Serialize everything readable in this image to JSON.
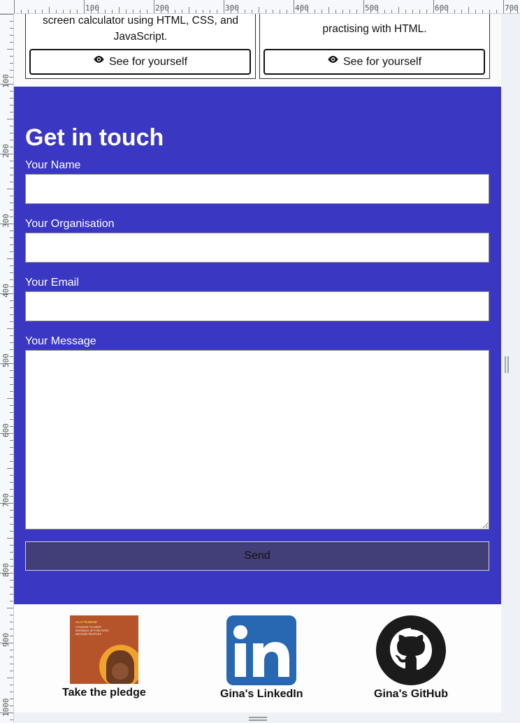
{
  "rulers": {
    "top_labels": [
      "100",
      "200",
      "300",
      "400",
      "500",
      "600",
      "700"
    ],
    "left_labels": [
      "100",
      "200",
      "300",
      "400",
      "500",
      "600",
      "700",
      "800",
      "900",
      "1000"
    ]
  },
  "projects": [
    {
      "description_lines": [
        "screen calculator using HTML, CSS, and",
        "JavaScript."
      ],
      "button_label": "See for yourself",
      "icon": "eye-icon"
    },
    {
      "description_lines": [
        "practising with HTML."
      ],
      "button_label": "See for yourself",
      "icon": "eye-icon"
    }
  ],
  "contact": {
    "title": "Get in touch",
    "bg_color": "#3a37c2",
    "fields": [
      {
        "label": "Your Name",
        "value": "",
        "placeholder": ""
      },
      {
        "label": "Your Organisation",
        "value": "",
        "placeholder": ""
      },
      {
        "label": "Your Email",
        "value": "",
        "placeholder": ""
      }
    ],
    "message_label": "Your Message",
    "send_label": "Send"
  },
  "footer": {
    "links": [
      {
        "label": "Take the pledge",
        "icon": "ally-pledge-image",
        "pledge_header": "ALLY PLEDGE",
        "pledge_text": "I PLEDGE TO KEEP SHOWING UP FOR FIRST NATIONS PEOPLES"
      },
      {
        "label": "Gina's LinkedIn",
        "icon": "linkedin-icon"
      },
      {
        "label": "Gina's GitHub",
        "icon": "github-icon"
      }
    ]
  }
}
